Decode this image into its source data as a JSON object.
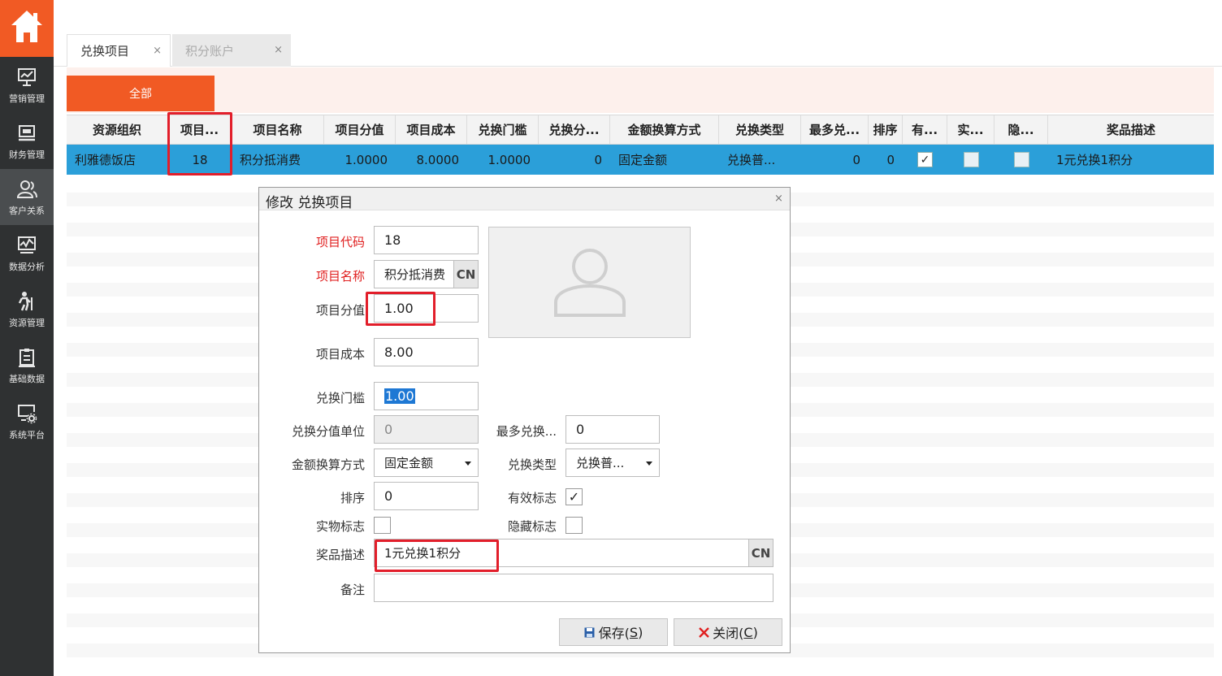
{
  "sidebar": {
    "home_icon": "home-icon",
    "items": [
      {
        "label": "营销管理",
        "icon": "presentation-board-icon"
      },
      {
        "label": "财务管理",
        "icon": "monitor-icon"
      },
      {
        "label": "客户关系",
        "icon": "users-icon",
        "active": true
      },
      {
        "label": "数据分析",
        "icon": "line-chart-icon"
      },
      {
        "label": "资源管理",
        "icon": "person-walking-icon"
      },
      {
        "label": "基础数据",
        "icon": "clipboard-icon"
      },
      {
        "label": "系统平台",
        "icon": "settings-monitor-icon"
      }
    ]
  },
  "tabs": [
    {
      "label": "兑换项目",
      "close": "×",
      "active": true
    },
    {
      "label": "积分账户",
      "close": "×",
      "active": false
    }
  ],
  "filter": {
    "all_label": "全部"
  },
  "grid": {
    "columns": [
      "资源组织",
      "项目...",
      "项目名称",
      "项目分值",
      "项目成本",
      "兑换门槛",
      "兑换分...",
      "金额换算方式",
      "兑换类型",
      "最多兑...",
      "排序",
      "有...",
      "实...",
      "隐...",
      "奖品描述"
    ],
    "rows": [
      {
        "org": "利雅德饭店",
        "code": "18",
        "name": "积分抵消费",
        "score": "1.0000",
        "cost": "8.0000",
        "threshold": "1.0000",
        "unit": "0",
        "calc_mode": "固定金额",
        "exchange_type": "兑换普...",
        "max_exchange": "0",
        "sort": "0",
        "valid": true,
        "physical": false,
        "hidden": false,
        "desc": "1元兑换1积分"
      }
    ]
  },
  "dialog": {
    "title": "修改 兑换项目",
    "close": "×",
    "fields": {
      "code": {
        "label": "项目代码",
        "value": "18"
      },
      "name": {
        "label": "项目名称",
        "value": "积分抵消费",
        "cn": "CN"
      },
      "score": {
        "label": "项目分值",
        "value": "1.00"
      },
      "cost": {
        "label": "项目成本",
        "value": "8.00"
      },
      "threshold": {
        "label": "兑换门槛",
        "value": "1.00"
      },
      "unit": {
        "label": "兑换分值单位",
        "value": "0"
      },
      "max": {
        "label": "最多兑换...",
        "value": "0"
      },
      "calc_mode": {
        "label": "金额换算方式",
        "value": "固定金额"
      },
      "exchange_type": {
        "label": "兑换类型",
        "value": "兑换普..."
      },
      "sort": {
        "label": "排序",
        "value": "0"
      },
      "valid": {
        "label": "有效标志",
        "checked": true
      },
      "physical": {
        "label": "实物标志",
        "checked": false
      },
      "hidden": {
        "label": "隐藏标志",
        "checked": false
      },
      "desc": {
        "label": "奖品描述",
        "value": "1元兑换1积分",
        "cn": "CN"
      },
      "remark": {
        "label": "备注",
        "value": ""
      }
    },
    "photo_icon": "user-avatar-placeholder-icon",
    "save": {
      "label": "保存(",
      "key": "S",
      "end": ")",
      "icon": "save-icon"
    },
    "close_btn": {
      "label": "关闭(",
      "key": "C",
      "end": ")",
      "icon": "x-icon"
    }
  },
  "colors": {
    "accent": "#f15a24",
    "selected_row": "#2b9fd9",
    "highlight": "#e21e2a",
    "sidebar": "#2f3132"
  }
}
